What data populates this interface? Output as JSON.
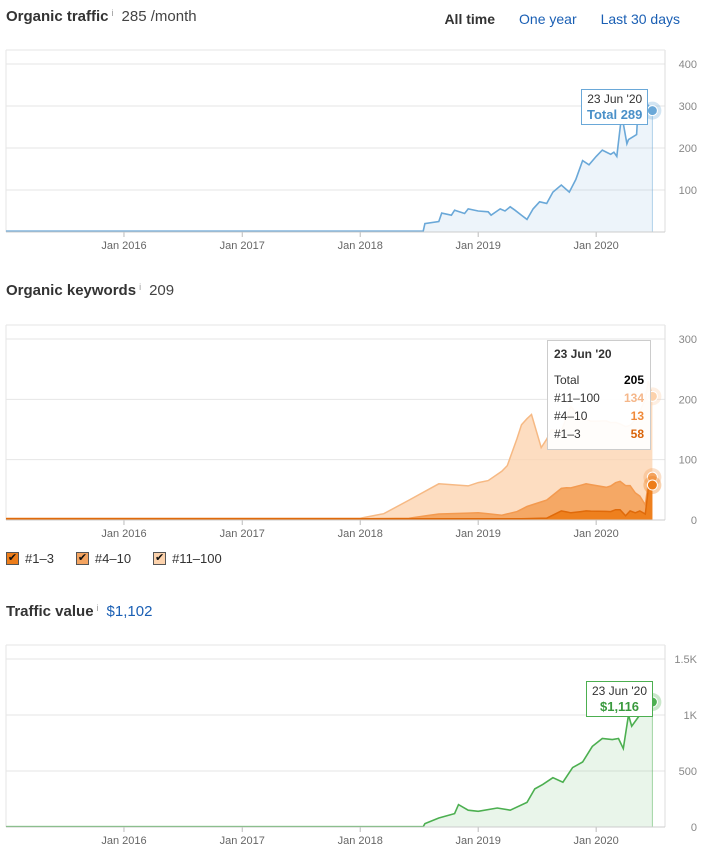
{
  "range_selector": {
    "options": [
      "All time",
      "One year",
      "Last 30 days"
    ],
    "active": "All time"
  },
  "panels": {
    "traffic": {
      "title": "Organic traffic",
      "info": "i",
      "value": "285 /month"
    },
    "keywords": {
      "title": "Organic keywords",
      "info": "i",
      "value": "209"
    },
    "value": {
      "title": "Traffic value",
      "info": "i",
      "value": "$1,102"
    }
  },
  "legend": [
    {
      "label": "#1–3",
      "checked": true,
      "check": "✔",
      "color": "#ed7d1a"
    },
    {
      "label": "#4–10",
      "checked": true,
      "check": "✔",
      "color": "#f4a460"
    },
    {
      "label": "#11–100",
      "checked": true,
      "check": "✔",
      "color": "#fcd2ac"
    }
  ],
  "tooltips": {
    "traffic": {
      "date": "23 Jun '20",
      "text": "Total 289"
    },
    "keywords": {
      "date": "23 Jun '20",
      "rows": [
        {
          "label": "Total",
          "value": "205",
          "color": "#000000"
        },
        {
          "label": "#11–100",
          "value": "134",
          "color": "#f5b78a"
        },
        {
          "label": "#4–10",
          "value": "13",
          "color": "#f08a3a"
        },
        {
          "label": "#1–3",
          "value": "58",
          "color": "#d9640a"
        }
      ]
    },
    "value": {
      "date": "23 Jun '20",
      "text": "$1,116"
    }
  },
  "chart_data": [
    {
      "type": "area",
      "title": "Organic traffic",
      "color": "#6aa8d8",
      "x_ticks": [
        "Jan 2016",
        "Jan 2017",
        "Jan 2018",
        "Jan 2019",
        "Jan 2020"
      ],
      "y_ticks": [
        "400",
        "300",
        "200",
        "100"
      ],
      "xlim": [
        "2015-01-01",
        "2020-08-01"
      ],
      "ylim": [
        0,
        400
      ],
      "grid": true,
      "series": [
        {
          "x": [
            "2015-01-01",
            "2018-07-15",
            "2018-07-20",
            "2018-09-01",
            "2018-09-10",
            "2018-10-10",
            "2018-10-20",
            "2018-11-20",
            "2018-12-01",
            "2019-01-01",
            "2019-02-01",
            "2019-02-10",
            "2019-03-10",
            "2019-03-25",
            "2019-04-10",
            "2019-04-25",
            "2019-05-15",
            "2019-06-01",
            "2019-06-20",
            "2019-07-10",
            "2019-08-01",
            "2019-08-20",
            "2019-09-15",
            "2019-10-10",
            "2019-10-30",
            "2019-11-20",
            "2019-12-10",
            "2020-01-01",
            "2020-01-20",
            "2020-02-15",
            "2020-02-25",
            "2020-03-05",
            "2020-03-20",
            "2020-04-05",
            "2020-04-10",
            "2020-05-05",
            "2020-05-10",
            "2020-06-01",
            "2020-06-23"
          ],
          "y": [
            2,
            2,
            20,
            25,
            45,
            40,
            52,
            44,
            55,
            50,
            48,
            40,
            55,
            50,
            60,
            52,
            40,
            30,
            55,
            72,
            68,
            95,
            112,
            95,
            125,
            170,
            160,
            180,
            195,
            185,
            190,
            180,
            280,
            210,
            220,
            232,
            300,
            310,
            289
          ]
        }
      ]
    },
    {
      "type": "area",
      "title": "Organic keywords",
      "stacked": true,
      "x_ticks": [
        "Jan 2016",
        "Jan 2017",
        "Jan 2018",
        "Jan 2019",
        "Jan 2020"
      ],
      "y_ticks": [
        "300",
        "200",
        "100",
        "0"
      ],
      "xlim": [
        "2015-01-01",
        "2020-08-01"
      ],
      "ylim": [
        0,
        300
      ],
      "grid": true,
      "series": [
        {
          "name": "#1–3",
          "color": "#ed7d1a",
          "x": [
            "2015-01-01",
            "2018-01-01",
            "2018-03-15",
            "2018-08-01",
            "2019-01-01",
            "2019-05-01",
            "2019-08-01",
            "2019-09-15",
            "2019-10-15",
            "2019-12-01",
            "2020-02-15",
            "2020-03-01",
            "2020-03-15",
            "2020-04-01",
            "2020-04-15",
            "2020-05-01",
            "2020-05-15",
            "2020-06-01",
            "2020-06-10",
            "2020-06-23"
          ],
          "y": [
            2,
            2,
            2,
            2,
            2,
            2,
            3,
            15,
            12,
            15,
            14,
            17,
            17,
            7,
            15,
            12,
            15,
            10,
            50,
            58
          ]
        },
        {
          "name": "#4–10",
          "color": "#f4a460",
          "x": [
            "2015-01-01",
            "2018-01-01",
            "2018-06-01",
            "2018-09-01",
            "2019-01-01",
            "2019-03-15",
            "2019-05-01",
            "2019-06-01",
            "2019-08-01",
            "2019-10-01",
            "2019-12-01",
            "2020-02-01",
            "2020-04-01",
            "2020-06-10",
            "2020-06-23"
          ],
          "y": [
            0,
            0,
            1,
            8,
            10,
            6,
            12,
            20,
            30,
            40,
            45,
            40,
            50,
            10,
            13
          ]
        },
        {
          "name": "#11–100",
          "color": "#fcd2ac",
          "x": [
            "2015-01-01",
            "2018-01-01",
            "2018-03-15",
            "2018-06-01",
            "2018-09-01",
            "2018-12-01",
            "2019-02-01",
            "2019-04-01",
            "2019-05-15",
            "2019-06-15",
            "2019-07-15",
            "2019-08-15",
            "2019-09-15",
            "2019-10-15",
            "2019-11-15",
            "2019-12-15",
            "2020-02-01",
            "2020-03-15",
            "2020-04-15",
            "2020-05-15",
            "2020-06-01",
            "2020-06-10",
            "2020-06-23"
          ],
          "y": [
            1,
            1,
            8,
            30,
            50,
            45,
            55,
            80,
            140,
            150,
            90,
            110,
            95,
            135,
            110,
            105,
            110,
            95,
            100,
            140,
            175,
            170,
            134
          ]
        }
      ]
    },
    {
      "type": "area",
      "title": "Traffic value",
      "color": "#4caf50",
      "x_ticks": [
        "Jan 2016",
        "Jan 2017",
        "Jan 2018",
        "Jan 2019",
        "Jan 2020"
      ],
      "y_ticks": [
        "1.5K",
        "1K",
        "500",
        "0"
      ],
      "xlim": [
        "2015-01-01",
        "2020-08-01"
      ],
      "ylim": [
        0,
        1500
      ],
      "grid": true,
      "series": [
        {
          "x": [
            "2015-01-01",
            "2018-07-15",
            "2018-07-20",
            "2018-09-01",
            "2018-10-20",
            "2018-11-01",
            "2018-12-01",
            "2019-01-01",
            "2019-03-01",
            "2019-04-10",
            "2019-06-01",
            "2019-06-25",
            "2019-07-20",
            "2019-08-20",
            "2019-09-20",
            "2019-10-20",
            "2019-11-20",
            "2019-12-20",
            "2020-01-20",
            "2020-02-20",
            "2020-03-10",
            "2020-03-25",
            "2020-04-10",
            "2020-04-20",
            "2020-05-15",
            "2020-06-01",
            "2020-06-23"
          ],
          "y": [
            3,
            3,
            30,
            80,
            120,
            200,
            150,
            140,
            170,
            150,
            220,
            340,
            380,
            440,
            400,
            530,
            580,
            720,
            790,
            780,
            790,
            700,
            1000,
            900,
            1000,
            1220,
            1116
          ]
        }
      ]
    }
  ]
}
